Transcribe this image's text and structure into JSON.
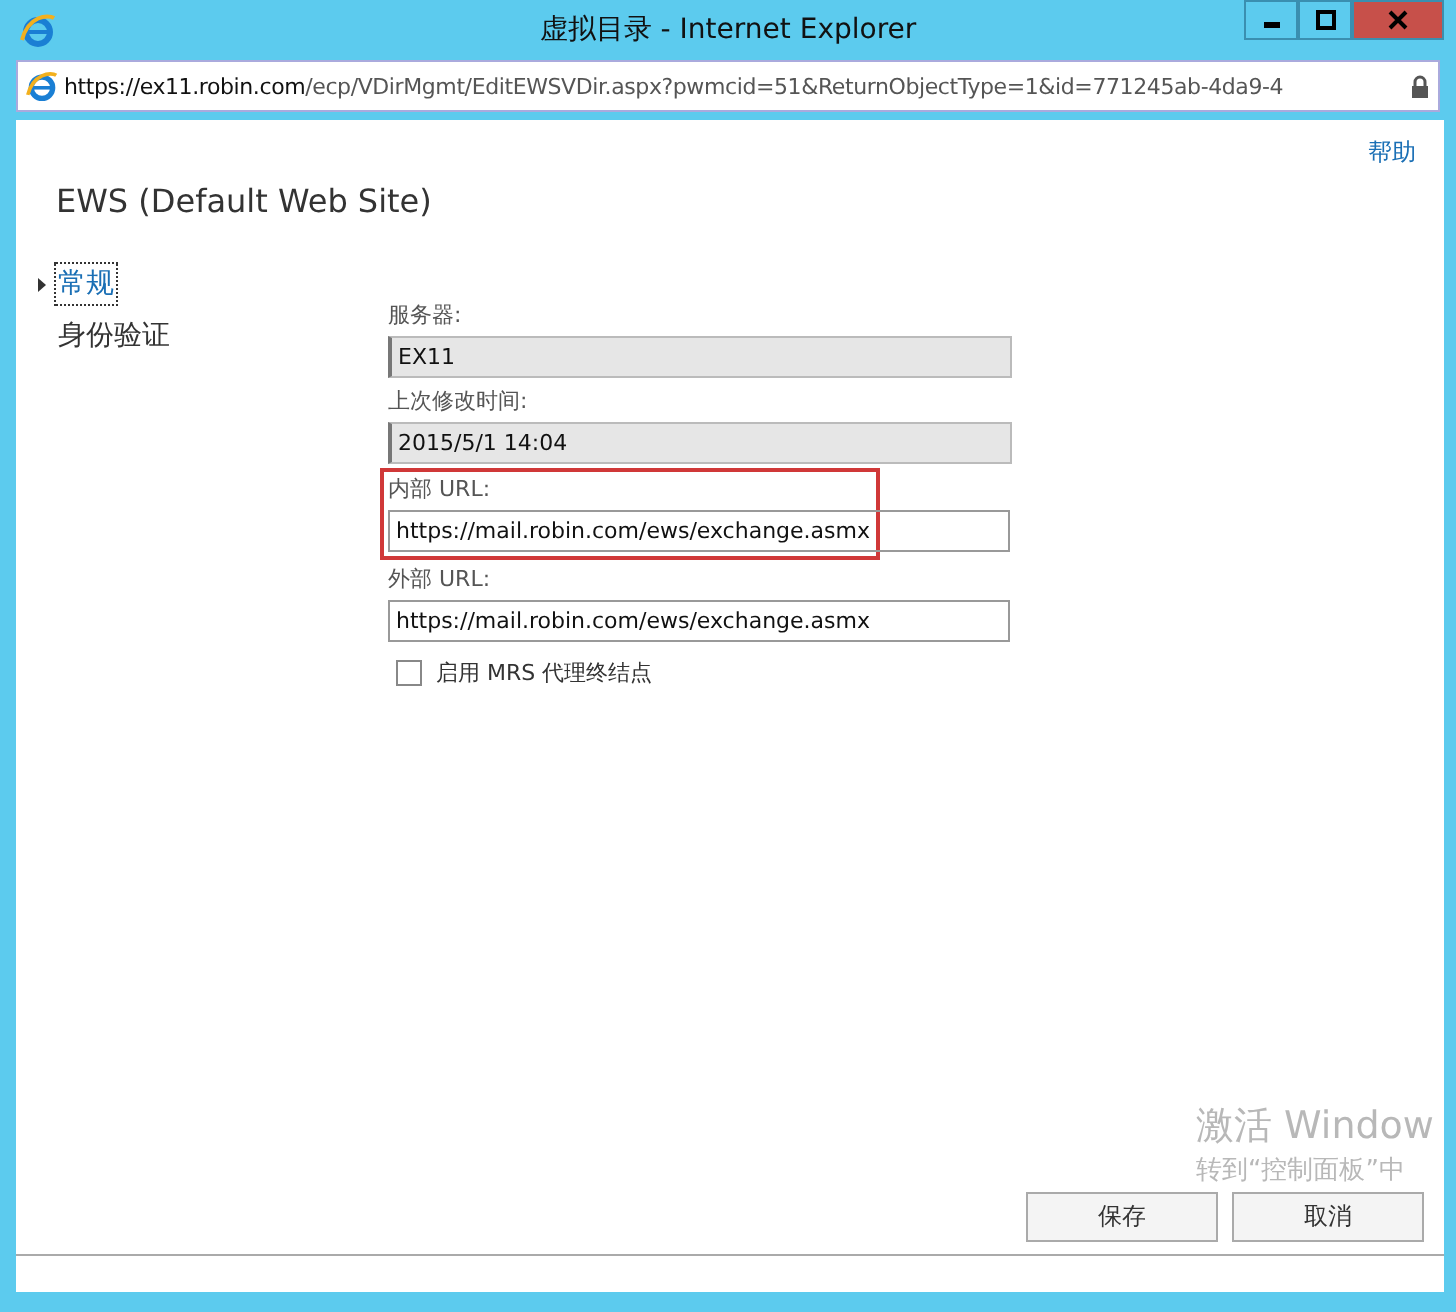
{
  "window": {
    "title": "虚拟目录 - Internet Explorer"
  },
  "address_bar": {
    "host_prefix": "https://",
    "host": "ex11.robin.com",
    "path": "/ecp/VDirMgmt/EditEWSVDir.aspx?pwmcid=51&ReturnObjectType=1&id=771245ab-4da9-4"
  },
  "help_link": "帮助",
  "page_title": "EWS (Default Web Site)",
  "sidebar": {
    "items": [
      {
        "label": "常规",
        "selected": true
      },
      {
        "label": "身份验证",
        "selected": false
      }
    ]
  },
  "form": {
    "fields": [
      {
        "label": "服务器:",
        "value": "EX11",
        "disabled": true,
        "highlighted": false
      },
      {
        "label": "上次修改时间:",
        "value": "2015/5/1 14:04",
        "disabled": true,
        "highlighted": false
      },
      {
        "label": "内部 URL:",
        "value": "https://mail.robin.com/ews/exchange.asmx",
        "disabled": false,
        "highlighted": true
      },
      {
        "label": "外部 URL:",
        "value": "https://mail.robin.com/ews/exchange.asmx",
        "disabled": false,
        "highlighted": false
      }
    ],
    "checkbox": {
      "label": "启用 MRS 代理终结点",
      "checked": false
    }
  },
  "activation_notice": {
    "title": "激活 Window",
    "line_1": "转到“控制面板”中"
  },
  "buttons": [
    "保存",
    "取消"
  ]
}
